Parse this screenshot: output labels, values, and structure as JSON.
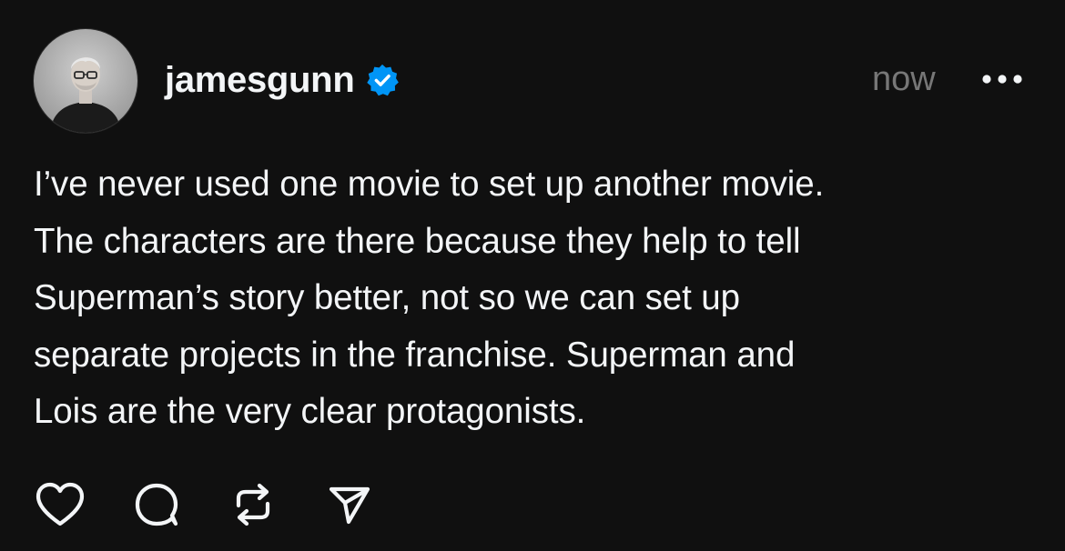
{
  "post": {
    "author": {
      "username": "jamesgunn",
      "verified": true,
      "avatar_icon": "profile-photo"
    },
    "timestamp": "now",
    "more_icon": "more-icon",
    "text": "I’ve never used one movie to set up another movie.\nThe characters are there because they help to tell\nSuperman’s story better, not so we can set up\nseparate projects in the franchise. Superman and\nLois are the very clear protagonists.",
    "actions": [
      {
        "name": "like",
        "icon": "heart-icon"
      },
      {
        "name": "reply",
        "icon": "comment-icon"
      },
      {
        "name": "repost",
        "icon": "repost-icon"
      },
      {
        "name": "share",
        "icon": "send-icon"
      }
    ]
  },
  "colors": {
    "background": "#101010",
    "text": "#f3f5f7",
    "secondary_text": "#777777",
    "verified_badge": "#0095f6"
  }
}
